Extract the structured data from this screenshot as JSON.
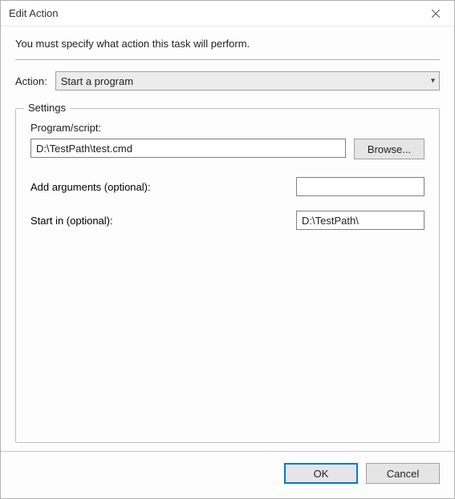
{
  "window": {
    "title": "Edit Action"
  },
  "instruction": "You must specify what action this task will perform.",
  "action": {
    "label": "Action:",
    "selected": "Start a program"
  },
  "settings": {
    "legend": "Settings",
    "program_label": "Program/script:",
    "program_value": "D:\\TestPath\\test.cmd",
    "browse_label": "Browse...",
    "arguments_label": "Add arguments (optional):",
    "arguments_value": "",
    "startin_label": "Start in (optional):",
    "startin_value": "D:\\TestPath\\"
  },
  "buttons": {
    "ok": "OK",
    "cancel": "Cancel"
  }
}
